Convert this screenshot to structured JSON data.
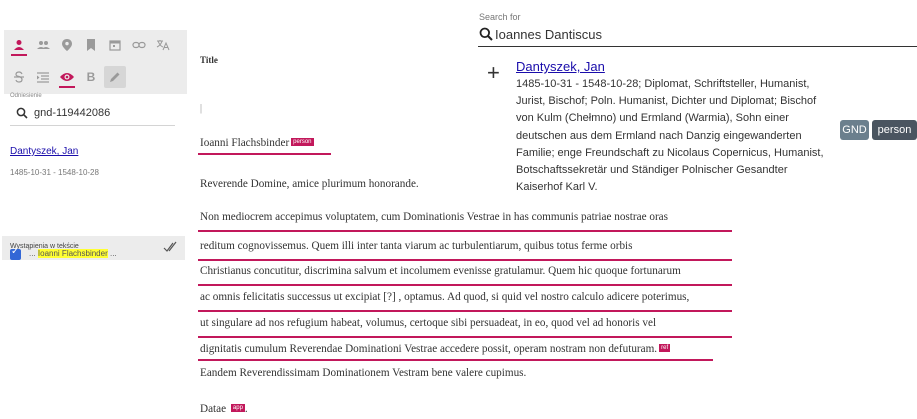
{
  "colors": {
    "accent": "#c2185b",
    "link": "#1a0dab",
    "highlight": "#ffff33",
    "checkbox": "#3367d6"
  },
  "sidebar": {
    "toolbar_icons": [
      "person-icon",
      "people-icon",
      "location-pin-icon",
      "bookmark-icon",
      "calendar-icon",
      "link-icon",
      "translate-icon",
      "strikethrough-icon",
      "indent-icon",
      "eye-icon",
      "bold-icon",
      "pencil-icon"
    ],
    "bold_label": "B",
    "reference_label": "Odniesienie",
    "reference_value": "gnd-119442086",
    "entity_name": "Dantyszek, Jan",
    "entity_dates": "1485-10-31 - 1548-10-28",
    "occurrences_label": "Wystąpienia w tekście",
    "occurrence_text": "Ioanni Flachsbinder",
    "occurrence_ellipsis_before": "...",
    "occurrence_ellipsis_after": "..."
  },
  "document": {
    "title": "Title",
    "caret": "|",
    "addressee": "Ioanni Flachsbinder",
    "addressee_tag": "person",
    "salutation": "Reverende Domine, amice plurimum honorande.",
    "lines": [
      "Non mediocrem accepimus voluptatem, cum Dominationis Vestrae in has communis patriae nostrae oras",
      "reditum cognovissemus. Quem illi inter tanta viarum ac turbulentiarum, quibus totus ferme orbis",
      "Christianus concutitur, discrimina salvum et incolumem evenisse gratulamur. Quem hic quoque fortunarum",
      "ac omnis felicitatis successus ut excipiat [?] , optamus. Ad quod, si quid vel nostro calculo adicere poterimus,",
      "ut singulare ad nos refugium habeat, volumus, certoque sibi persuadeat, in eo, quod vel ad honoris vel",
      "dignitatis cumulum Reverendae Dominationi Vestrae accedere possit, operam nostram non defuturam."
    ],
    "ref_tag": "ref",
    "closing": "Eandem Reverendissimam Dominationem Vestram bene valere cupimus.",
    "datae": "Datae",
    "app_tag": "app",
    "datae_end": "."
  },
  "search": {
    "label": "Search for",
    "value": "Ioannes Dantiscus",
    "add_symbol": "+",
    "result": {
      "name": "Dantyszek, Jan",
      "description": "1485-10-31 - 1548-10-28; Diplomat, Schriftsteller, Humanist, Jurist, Bischof; Poln. Humanist, Dichter und Diplomat; Bischof von Kulm (Chełmno) und Ermland (Warmia), Sohn einer deutschen aus dem Ermland nach Danzig eingewanderten Familie; enge Freundschaft zu Nicolaus Copernicus, Humanist, Botschaftssekretär und Ständiger Polnischer Gesandter Kaiserhof Karl V.",
      "badge_source": "GND",
      "badge_type": "person"
    }
  }
}
